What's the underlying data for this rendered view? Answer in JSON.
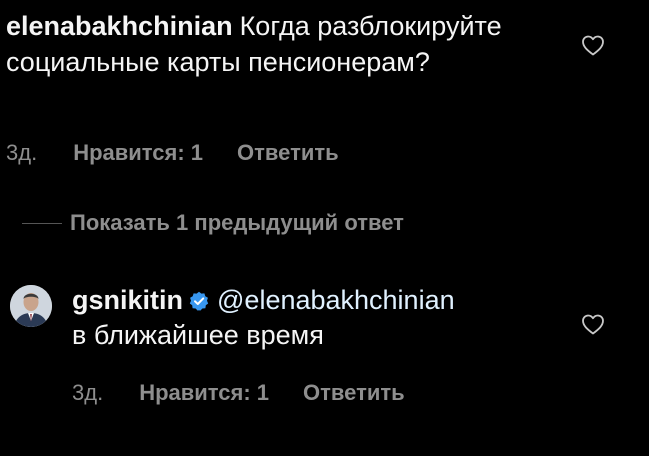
{
  "comment": {
    "username": "elenabakhchinian",
    "text": "Когда разблокируйте социальные карты пенсионерам?",
    "time": "3д.",
    "likes": "Нравится: 1",
    "reply": "Ответить"
  },
  "replies_toggle": {
    "label": "Показать 1 предыдущий ответ"
  },
  "reply": {
    "username": "gsnikitin",
    "mention": "@elenabakhchinian",
    "text": "в ближайшее время",
    "time": "3д.",
    "likes": "Нравится: 1",
    "reply": "Ответить"
  },
  "icons": {
    "like": "heart-outline-icon",
    "verified": "verified-badge-icon",
    "avatar": "user-avatar"
  },
  "colors": {
    "background": "#000000",
    "text": "#f5f5f5",
    "secondary": "#8e8e8e",
    "verified": "#3897f0"
  }
}
